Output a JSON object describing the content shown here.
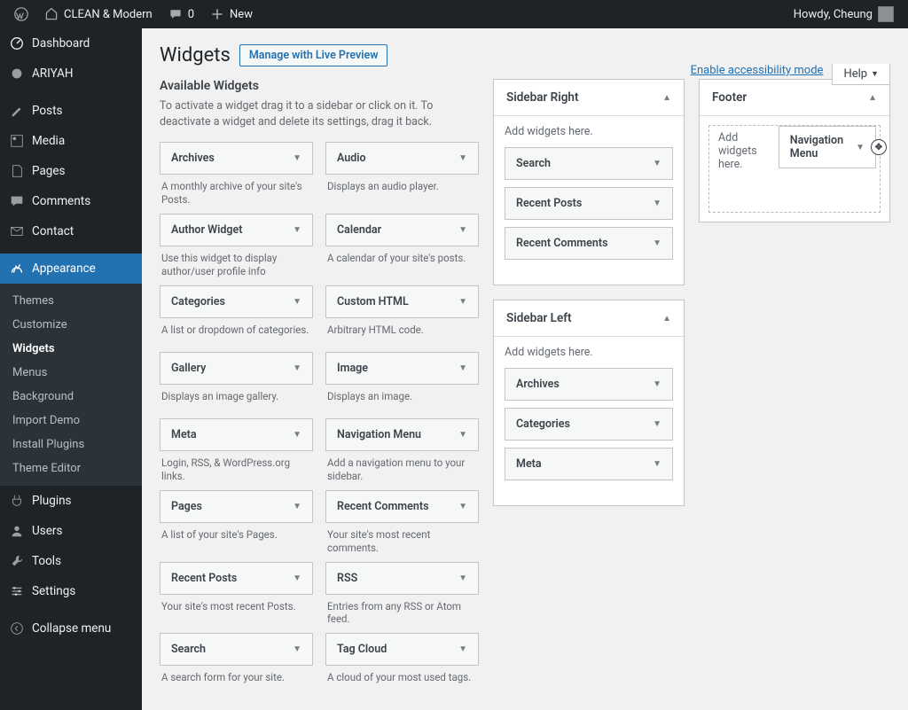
{
  "adminbar": {
    "site": "CLEAN & Modern",
    "comments": "0",
    "new": "New",
    "howdy": "Howdy, Cheung"
  },
  "toplinks": {
    "accessibility": "Enable accessibility mode",
    "help": "Help"
  },
  "page": {
    "title": "Widgets",
    "live_preview": "Manage with Live Preview"
  },
  "sidebar": {
    "items": [
      {
        "label": "Dashboard"
      },
      {
        "label": "ARIYAH"
      },
      {
        "label": "Posts"
      },
      {
        "label": "Media"
      },
      {
        "label": "Pages"
      },
      {
        "label": "Comments"
      },
      {
        "label": "Contact"
      },
      {
        "label": "Appearance"
      },
      {
        "label": "Plugins"
      },
      {
        "label": "Users"
      },
      {
        "label": "Tools"
      },
      {
        "label": "Settings"
      },
      {
        "label": "Collapse menu"
      }
    ],
    "appearance_sub": [
      {
        "label": "Themes"
      },
      {
        "label": "Customize"
      },
      {
        "label": "Widgets"
      },
      {
        "label": "Menus"
      },
      {
        "label": "Background"
      },
      {
        "label": "Import Demo"
      },
      {
        "label": "Install Plugins"
      },
      {
        "label": "Theme Editor"
      }
    ]
  },
  "available": {
    "title": "Available Widgets",
    "desc": "To activate a widget drag it to a sidebar or click on it. To deactivate a widget and delete its settings, drag it back.",
    "widgets": [
      {
        "name": "Archives",
        "desc": "A monthly archive of your site's Posts."
      },
      {
        "name": "Audio",
        "desc": "Displays an audio player."
      },
      {
        "name": "Author Widget",
        "desc": "Use this widget to display author/user profile info"
      },
      {
        "name": "Calendar",
        "desc": "A calendar of your site's posts."
      },
      {
        "name": "Categories",
        "desc": "A list or dropdown of categories."
      },
      {
        "name": "Custom HTML",
        "desc": "Arbitrary HTML code."
      },
      {
        "name": "Gallery",
        "desc": "Displays an image gallery."
      },
      {
        "name": "Image",
        "desc": "Displays an image."
      },
      {
        "name": "Meta",
        "desc": "Login, RSS, & WordPress.org links."
      },
      {
        "name": "Navigation Menu",
        "desc": "Add a navigation menu to your sidebar."
      },
      {
        "name": "Pages",
        "desc": "A list of your site's Pages."
      },
      {
        "name": "Recent Comments",
        "desc": "Your site's most recent comments."
      },
      {
        "name": "Recent Posts",
        "desc": "Your site's most recent Posts."
      },
      {
        "name": "RSS",
        "desc": "Entries from any RSS or Atom feed."
      },
      {
        "name": "Search",
        "desc": "A search form for your site."
      },
      {
        "name": "Tag Cloud",
        "desc": "A cloud of your most used tags."
      }
    ]
  },
  "areas": {
    "sidebar_right": {
      "title": "Sidebar Right",
      "hint": "Add widgets here.",
      "widgets": [
        "Search",
        "Recent Posts",
        "Recent Comments"
      ]
    },
    "sidebar_left": {
      "title": "Sidebar Left",
      "hint": "Add widgets here.",
      "widgets": [
        "Archives",
        "Categories",
        "Meta"
      ]
    },
    "footer": {
      "title": "Footer",
      "hint": "Add widgets here.",
      "dragging": "Navigation Menu"
    }
  }
}
